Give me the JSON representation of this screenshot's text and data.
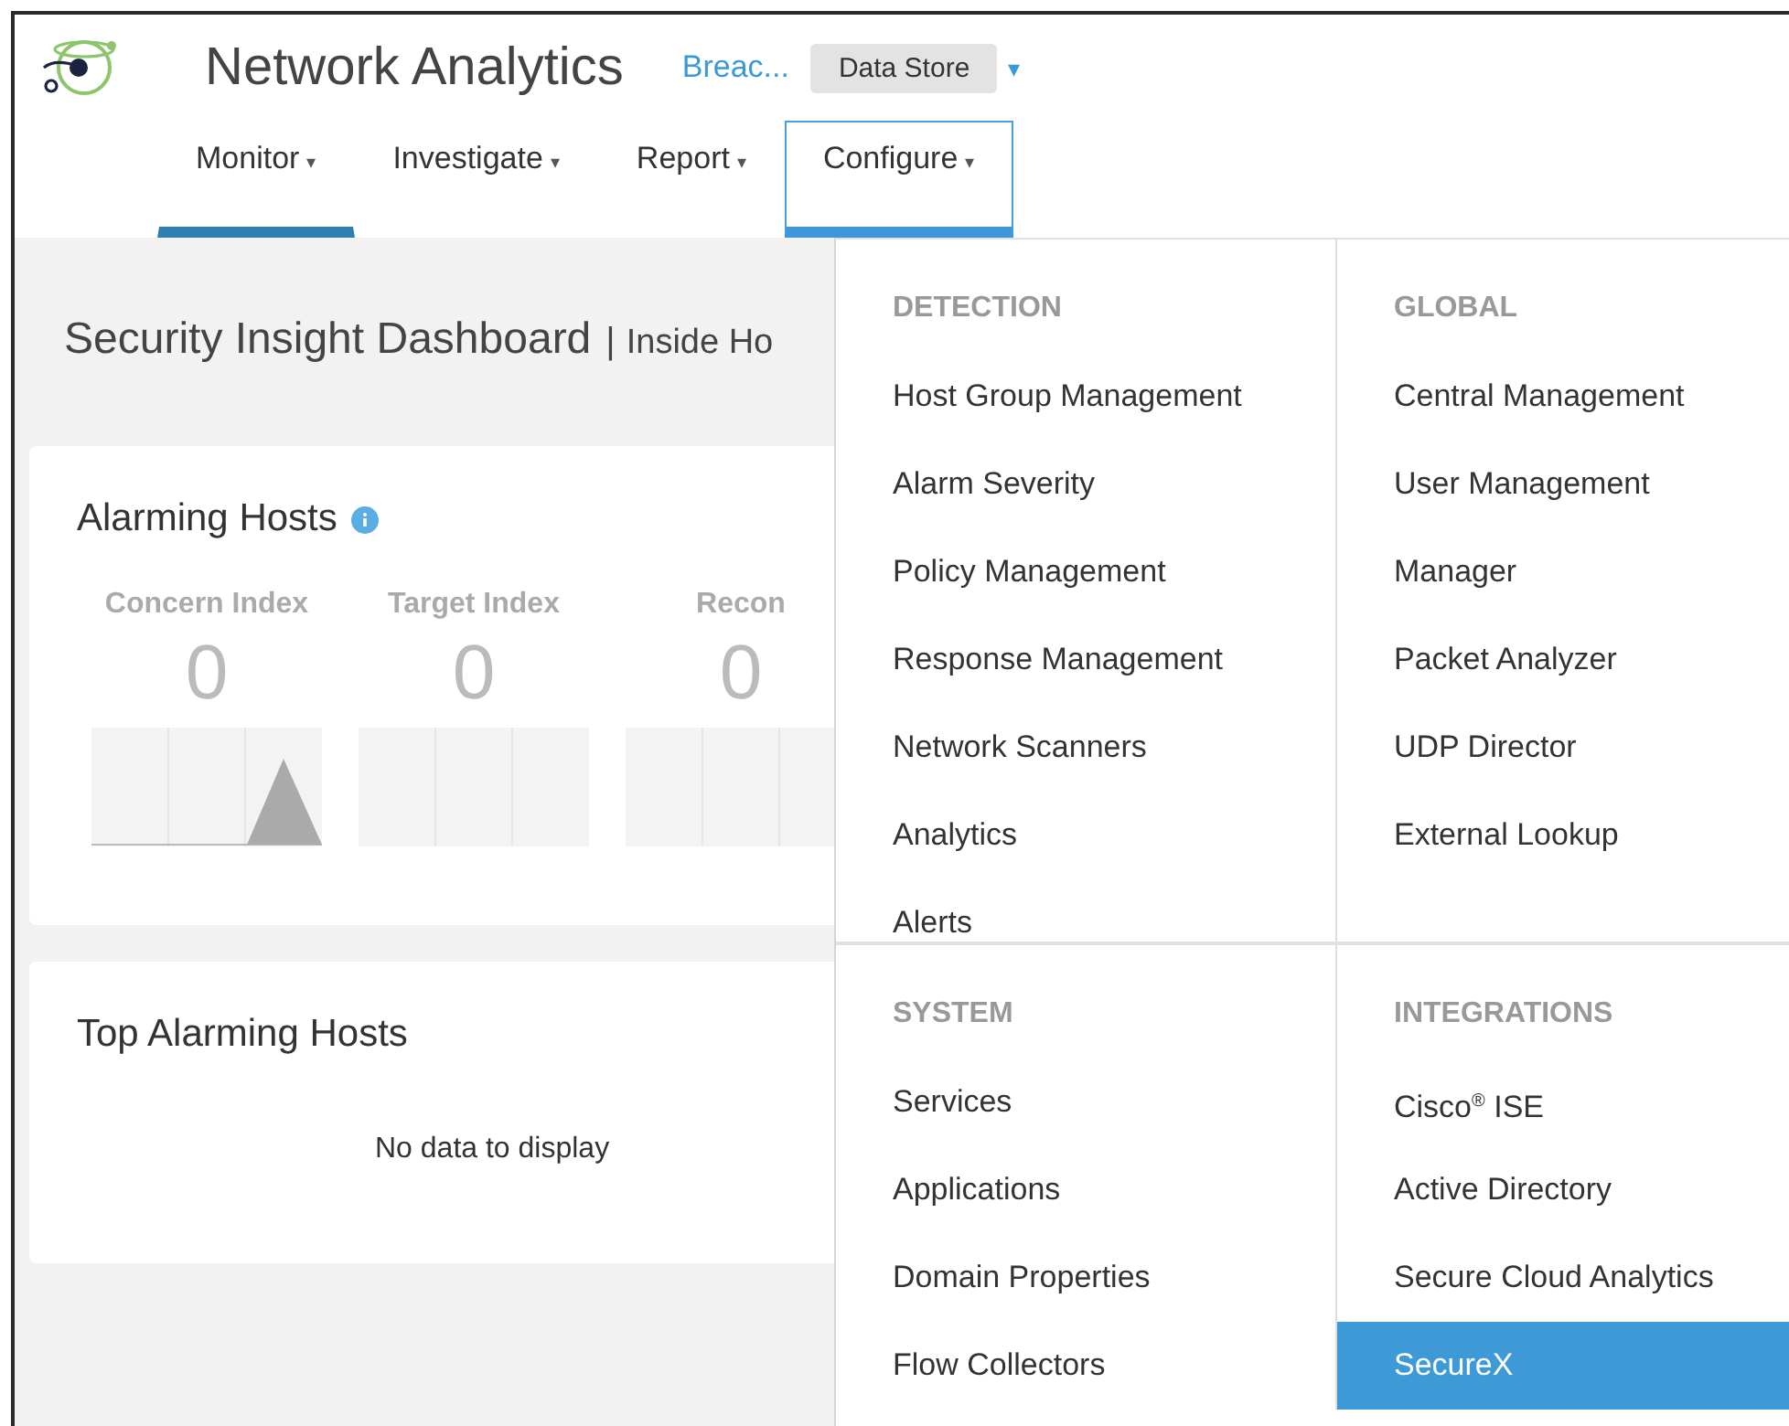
{
  "header": {
    "title": "Network Analytics",
    "breadcrumb": "Breac...",
    "domain": "Data Store",
    "domain_caret": "▾"
  },
  "nav": [
    {
      "label": "Monitor",
      "caret": "▾",
      "selected": true,
      "expanded": false
    },
    {
      "label": "Investigate",
      "caret": "▾",
      "selected": false,
      "expanded": false
    },
    {
      "label": "Report",
      "caret": "▾",
      "selected": false,
      "expanded": false
    },
    {
      "label": "Configure",
      "caret": "▾",
      "selected": false,
      "expanded": true
    }
  ],
  "page": {
    "title": "Security Insight Dashboard",
    "separator": "|",
    "subtitle": "Inside Ho"
  },
  "alarming_hosts": {
    "title": "Alarming Hosts",
    "metrics": [
      {
        "label": "Concern Index",
        "value": "0",
        "kind": "spike"
      },
      {
        "label": "Target Index",
        "value": "0",
        "kind": "flat"
      },
      {
        "label": "Recon",
        "value": "0",
        "kind": "flat"
      }
    ]
  },
  "top_alarming_hosts": {
    "title": "Top Alarming Hosts",
    "empty_text": "No data to display"
  },
  "configure_menu": {
    "sections": [
      {
        "title": "DETECTION",
        "items": [
          {
            "label": "Host Group Management",
            "selected": false
          },
          {
            "label": "Alarm Severity",
            "selected": false
          },
          {
            "label": "Policy Management",
            "selected": false
          },
          {
            "label": "Response Management",
            "selected": false
          },
          {
            "label": "Network Scanners",
            "selected": false
          },
          {
            "label": "Analytics",
            "selected": false
          },
          {
            "label": "Alerts",
            "selected": false
          }
        ]
      },
      {
        "title": "GLOBAL",
        "items": [
          {
            "label": "Central Management",
            "selected": false
          },
          {
            "label": "User Management",
            "selected": false
          },
          {
            "label": "Manager",
            "selected": false
          },
          {
            "label": "Packet Analyzer",
            "selected": false
          },
          {
            "label": "UDP Director",
            "selected": false
          },
          {
            "label": "External Lookup",
            "selected": false
          }
        ]
      },
      {
        "title": "SYSTEM",
        "items": [
          {
            "label": "Services",
            "selected": false
          },
          {
            "label": "Applications",
            "selected": false
          },
          {
            "label": "Domain Properties",
            "selected": false
          },
          {
            "label": "Flow Collectors",
            "selected": false
          }
        ]
      },
      {
        "title": "INTEGRATIONS",
        "items": [
          {
            "label": "Cisco$^{®}$ ISE",
            "selected": false
          },
          {
            "label": "Active Directory",
            "selected": false
          },
          {
            "label": "Secure Cloud Analytics",
            "selected": false
          },
          {
            "label": "SecureX",
            "selected": true
          }
        ]
      }
    ]
  }
}
